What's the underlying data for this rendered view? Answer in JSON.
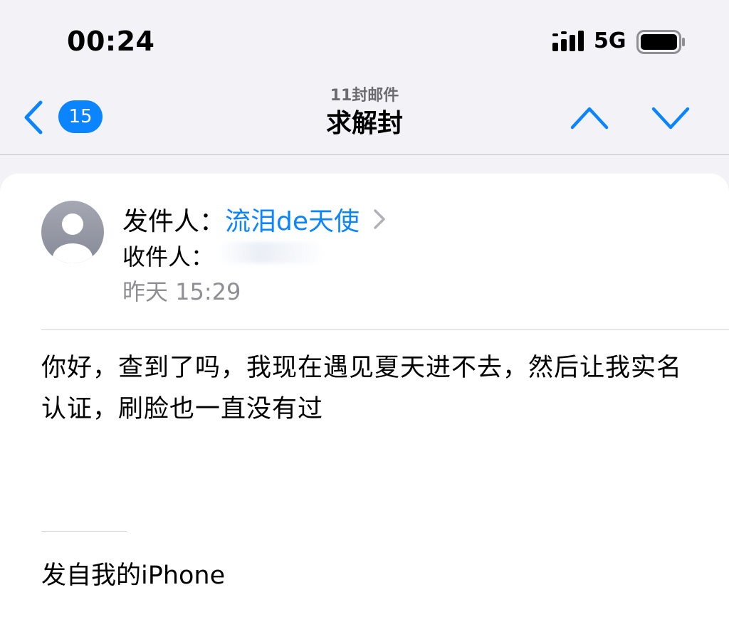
{
  "status_bar": {
    "time": "00:24",
    "network": "5G"
  },
  "nav": {
    "badge_count": "15",
    "message_count": "11封邮件",
    "title": "求解封"
  },
  "mail": {
    "from_label": "发件人：",
    "sender_name": "流泪de天使",
    "to_label": "收件人：",
    "date": "昨天 15:29",
    "body": "你好，查到了吗，我现在遇见夏天进不去，然后让我实名认证，刷脸也一直没有过",
    "signature": "发自我的iPhone"
  },
  "colors": {
    "accent": "#0a84ff",
    "secondary_text": "#8e8e93",
    "background": "#f2f2f7"
  },
  "icons": [
    "signal-icon",
    "battery-icon",
    "back-chevron-icon",
    "up-chevron-icon",
    "down-chevron-icon",
    "avatar-icon",
    "disclosure-chevron-icon"
  ]
}
